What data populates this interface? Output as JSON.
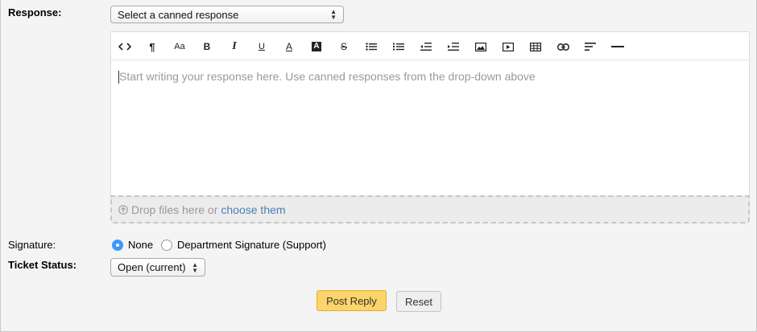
{
  "response": {
    "label": "Response:",
    "select_value": "Select a canned response"
  },
  "toolbar": [
    {
      "name": "code-view-icon",
      "glyph": "<>"
    },
    {
      "name": "paragraph-icon",
      "glyph": "¶"
    },
    {
      "name": "font-size-icon",
      "glyph": "Aa"
    },
    {
      "name": "bold-icon",
      "glyph": "B"
    },
    {
      "name": "italic-icon",
      "glyph": "I"
    },
    {
      "name": "underline-icon",
      "glyph": "U"
    },
    {
      "name": "font-color-icon",
      "glyph": "A"
    },
    {
      "name": "highlight-color-icon",
      "glyph": "A"
    },
    {
      "name": "strikethrough-icon",
      "glyph": "S"
    },
    {
      "name": "bullet-list-icon",
      "glyph": ""
    },
    {
      "name": "numbered-list-icon",
      "glyph": ""
    },
    {
      "name": "outdent-icon",
      "glyph": ""
    },
    {
      "name": "indent-icon",
      "glyph": ""
    },
    {
      "name": "image-icon",
      "glyph": ""
    },
    {
      "name": "video-icon",
      "glyph": ""
    },
    {
      "name": "table-icon",
      "glyph": ""
    },
    {
      "name": "link-icon",
      "glyph": ""
    },
    {
      "name": "align-icon",
      "glyph": ""
    },
    {
      "name": "horizontal-rule-icon",
      "glyph": ""
    }
  ],
  "editor": {
    "placeholder": "Start writing your response here. Use canned responses from the drop-down above"
  },
  "dropzone": {
    "text": "Drop files here or",
    "link": "choose them"
  },
  "signature": {
    "label": "Signature:",
    "options": [
      {
        "label": "None",
        "selected": true
      },
      {
        "label": "Department Signature (Support)",
        "selected": false
      }
    ]
  },
  "ticket_status": {
    "label": "Ticket Status:",
    "select_value": "Open (current)"
  },
  "buttons": {
    "post_reply": "Post Reply",
    "reset": "Reset"
  },
  "colors": {
    "primary_button": "#fdd469",
    "radio_selected": "#3b99fc",
    "link": "#4a7fb5"
  }
}
